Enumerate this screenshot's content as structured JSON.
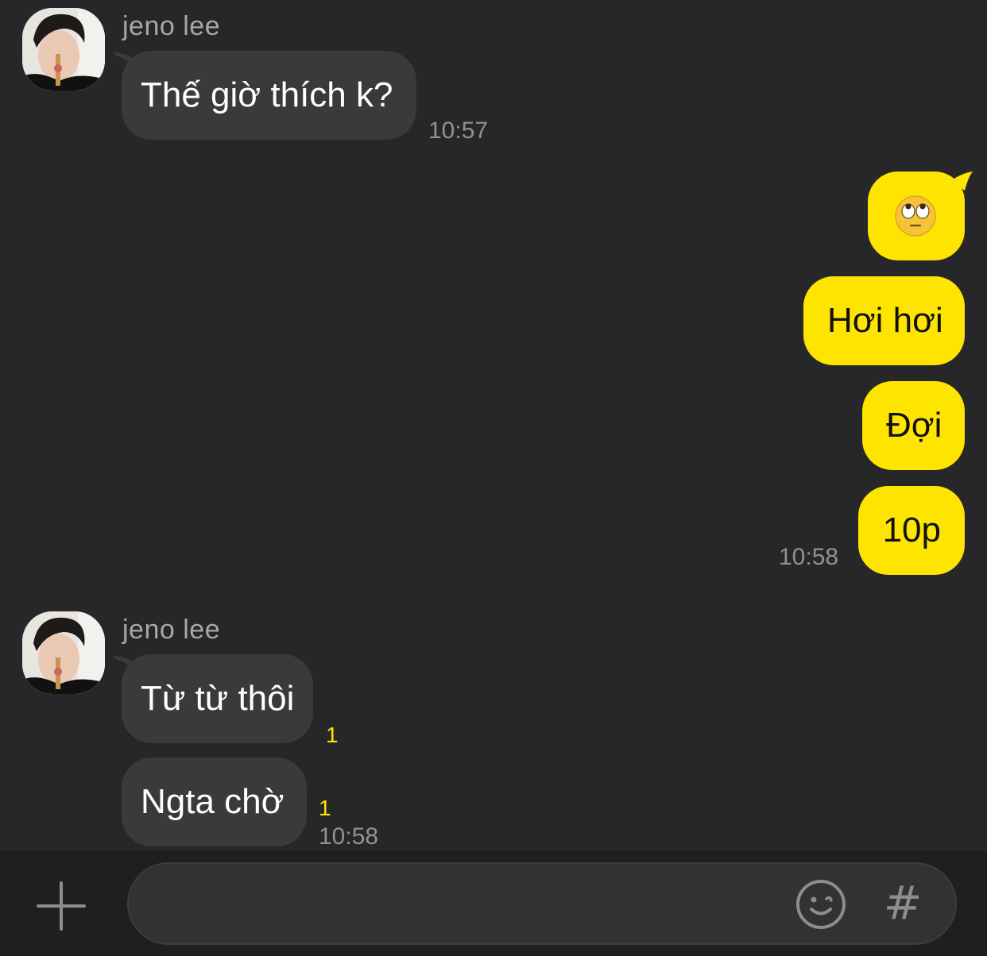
{
  "messages": [
    {
      "sender": "jeno lee",
      "text": "Thế giờ thích k?",
      "time": "10:57"
    },
    {
      "sender": "me",
      "emoji": "face-with-rolling-eyes-icon"
    },
    {
      "sender": "me",
      "text": "Hơi hơi"
    },
    {
      "sender": "me",
      "text": "Đợi"
    },
    {
      "sender": "me",
      "text": "10p",
      "time": "10:58"
    },
    {
      "sender": "jeno lee",
      "text": "Từ từ thôi",
      "unread": "1"
    },
    {
      "sender": "jeno lee",
      "text": "Ngta chờ",
      "unread": "1",
      "time": "10:58"
    }
  ],
  "input_bar": {
    "placeholder": "",
    "value": "",
    "hash_label": "#",
    "plus_icon": "plus-icon",
    "emoji_icon": "smiley-icon"
  },
  "colors": {
    "background": "#27272a",
    "incoming_bubble": "#3a3a3d",
    "outgoing_bubble": "#fee500",
    "unread": "#fee500",
    "input_bar": "#1f1f21"
  }
}
